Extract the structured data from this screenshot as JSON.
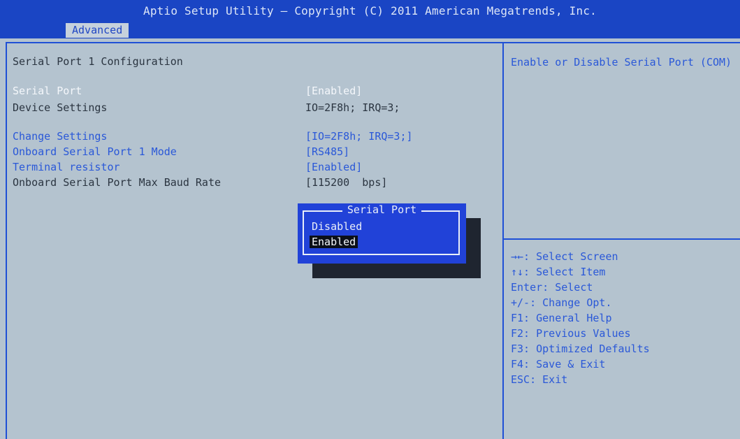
{
  "header": {
    "title": "Aptio Setup Utility – Copyright (C) 2011 American Megatrends, Inc.",
    "active_tab": "Advanced"
  },
  "main": {
    "section_title": "Serial Port 1 Configuration",
    "rows": [
      {
        "label": "Serial Port",
        "value": "[Enabled]"
      },
      {
        "label": "Device Settings",
        "value": "IO=2F8h; IRQ=3;"
      },
      {
        "label": "Change Settings",
        "value": "[IO=2F8h; IRQ=3;]"
      },
      {
        "label": "Onboard Serial Port 1 Mode",
        "value": "[RS485]"
      },
      {
        "label": "Terminal resistor",
        "value": "[Enabled]"
      },
      {
        "label": "Onboard Serial Port Max Baud Rate",
        "value": "[115200  bps]"
      }
    ]
  },
  "popup": {
    "title": "Serial Port",
    "options": [
      "Disabled",
      "Enabled"
    ],
    "selected": "Enabled"
  },
  "help": {
    "description": "Enable or Disable Serial Port (COM)",
    "keys": [
      "→←: Select Screen",
      "↑↓: Select Item",
      "Enter: Select",
      "+/-: Change Opt.",
      "F1: General Help",
      "F2: Previous Values",
      "F3: Optimized Defaults",
      "F4: Save & Exit",
      "ESC: Exit"
    ]
  },
  "colors": {
    "header_bg": "#1a45c4",
    "screen_bg": "#b4c3cf",
    "link_text": "#2a58d8",
    "active_text": "#f4f7fb",
    "static_text": "#2b3541",
    "popup_bg": "#2142d8"
  }
}
